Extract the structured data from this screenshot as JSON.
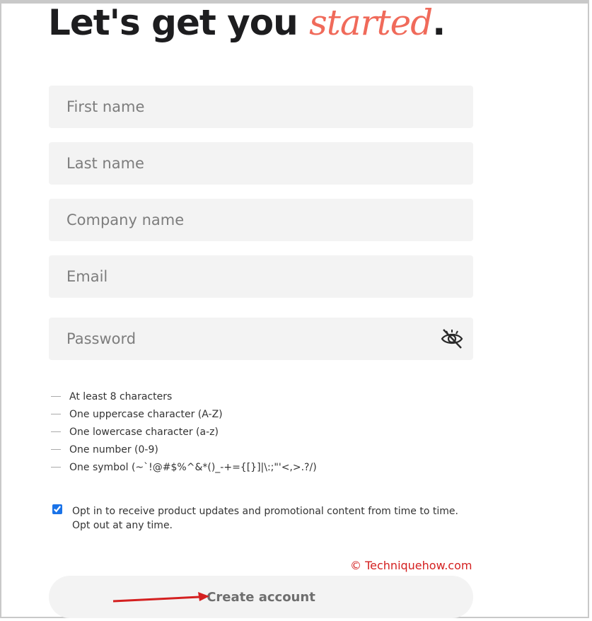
{
  "header": {
    "title_prefix": "Let's get you ",
    "title_accent": "started",
    "title_suffix": "."
  },
  "form": {
    "first_name": {
      "placeholder": "First name",
      "value": ""
    },
    "last_name": {
      "placeholder": "Last name",
      "value": ""
    },
    "company_name": {
      "placeholder": "Company name",
      "value": ""
    },
    "email": {
      "placeholder": "Email",
      "value": ""
    },
    "password": {
      "placeholder": "Password",
      "value": "",
      "toggle_icon": "eye-slash-icon"
    }
  },
  "password_rules": [
    "At least 8 characters",
    "One uppercase character (A-Z)",
    "One lowercase character (a-z)",
    "One number (0-9)",
    "One symbol (~`!@#$%^&*()_-+={[}]|\\:;\"'<,>.?/)"
  ],
  "optin": {
    "checked": true,
    "line1": "Opt in to receive product updates and promotional content from time to time.",
    "line2": "Opt out at any time."
  },
  "watermark": "© Techniquehow.com",
  "submit": {
    "label": "Create account"
  },
  "colors": {
    "accent": "#f06a5a",
    "field_bg": "#f3f3f3",
    "annotation_red": "#d42020"
  }
}
